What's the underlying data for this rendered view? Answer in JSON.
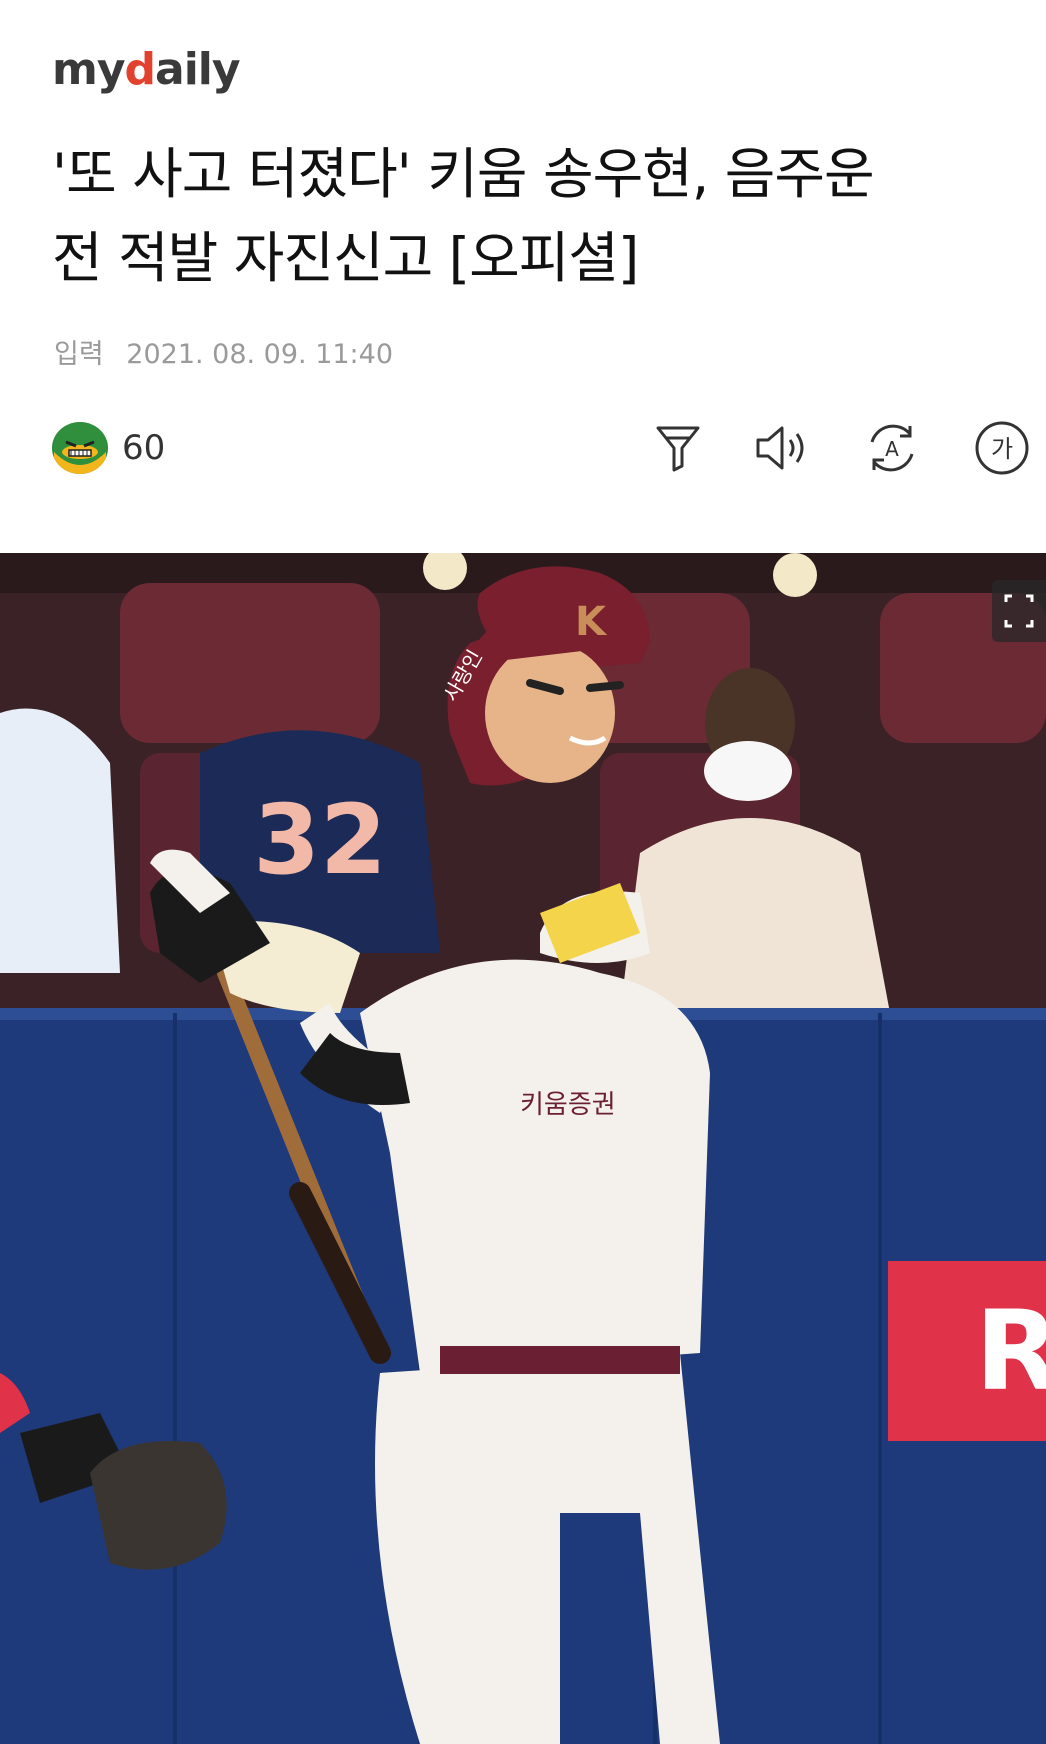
{
  "header": {
    "logo_prefix": "my",
    "logo_accent": "d",
    "logo_suffix": "aily"
  },
  "article": {
    "headline_line1": "'또 사고 터졌다' 키움 송우현, 음주운",
    "headline_line2": "전 적발 자진신고 [오피셜]",
    "date_label": "입력",
    "date_value": "2021. 08. 09. 11:40"
  },
  "toolbar": {
    "reaction_count": "60",
    "font_size_button": "가",
    "translate_button": "A"
  },
  "photo": {
    "sign_text": "R",
    "jersey_number": "32",
    "helmet_letter": "K",
    "helmet_sponsor": "사랑인",
    "uniform_text": "키움증권"
  },
  "colors": {
    "brand_accent": "#e2412e",
    "wall_blue": "#1f3a7a",
    "seat_maroon": "#6b2a34",
    "sign_red": "#e0334a"
  },
  "icons": [
    "reaction-face-icon",
    "filter-icon",
    "speaker-icon",
    "translate-icon",
    "font-size-icon",
    "fullscreen-icon"
  ]
}
